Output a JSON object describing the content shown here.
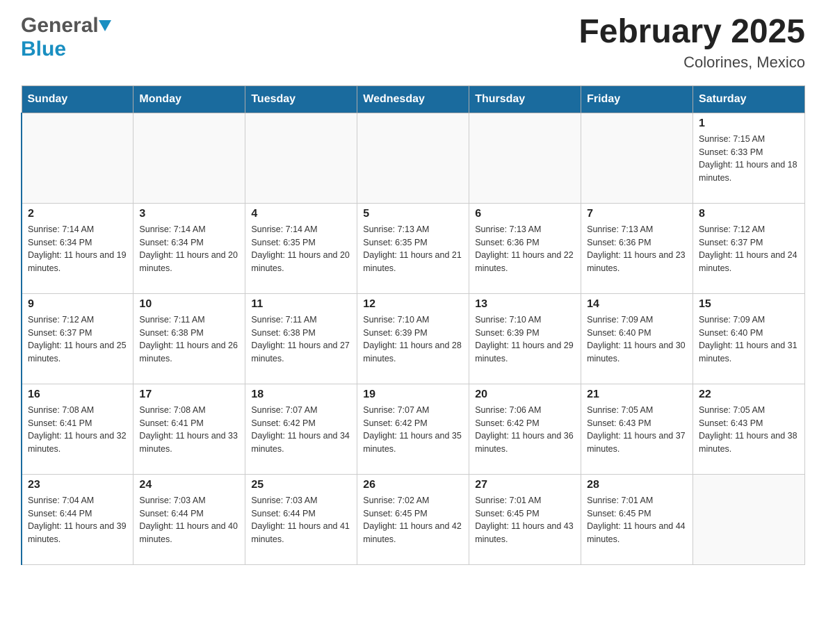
{
  "header": {
    "logo_general": "General",
    "logo_blue": "Blue",
    "month_title": "February 2025",
    "location": "Colorines, Mexico"
  },
  "days_of_week": [
    "Sunday",
    "Monday",
    "Tuesday",
    "Wednesday",
    "Thursday",
    "Friday",
    "Saturday"
  ],
  "weeks": [
    [
      {
        "day": "",
        "info": ""
      },
      {
        "day": "",
        "info": ""
      },
      {
        "day": "",
        "info": ""
      },
      {
        "day": "",
        "info": ""
      },
      {
        "day": "",
        "info": ""
      },
      {
        "day": "",
        "info": ""
      },
      {
        "day": "1",
        "info": "Sunrise: 7:15 AM\nSunset: 6:33 PM\nDaylight: 11 hours and 18 minutes."
      }
    ],
    [
      {
        "day": "2",
        "info": "Sunrise: 7:14 AM\nSunset: 6:34 PM\nDaylight: 11 hours and 19 minutes."
      },
      {
        "day": "3",
        "info": "Sunrise: 7:14 AM\nSunset: 6:34 PM\nDaylight: 11 hours and 20 minutes."
      },
      {
        "day": "4",
        "info": "Sunrise: 7:14 AM\nSunset: 6:35 PM\nDaylight: 11 hours and 20 minutes."
      },
      {
        "day": "5",
        "info": "Sunrise: 7:13 AM\nSunset: 6:35 PM\nDaylight: 11 hours and 21 minutes."
      },
      {
        "day": "6",
        "info": "Sunrise: 7:13 AM\nSunset: 6:36 PM\nDaylight: 11 hours and 22 minutes."
      },
      {
        "day": "7",
        "info": "Sunrise: 7:13 AM\nSunset: 6:36 PM\nDaylight: 11 hours and 23 minutes."
      },
      {
        "day": "8",
        "info": "Sunrise: 7:12 AM\nSunset: 6:37 PM\nDaylight: 11 hours and 24 minutes."
      }
    ],
    [
      {
        "day": "9",
        "info": "Sunrise: 7:12 AM\nSunset: 6:37 PM\nDaylight: 11 hours and 25 minutes."
      },
      {
        "day": "10",
        "info": "Sunrise: 7:11 AM\nSunset: 6:38 PM\nDaylight: 11 hours and 26 minutes."
      },
      {
        "day": "11",
        "info": "Sunrise: 7:11 AM\nSunset: 6:38 PM\nDaylight: 11 hours and 27 minutes."
      },
      {
        "day": "12",
        "info": "Sunrise: 7:10 AM\nSunset: 6:39 PM\nDaylight: 11 hours and 28 minutes."
      },
      {
        "day": "13",
        "info": "Sunrise: 7:10 AM\nSunset: 6:39 PM\nDaylight: 11 hours and 29 minutes."
      },
      {
        "day": "14",
        "info": "Sunrise: 7:09 AM\nSunset: 6:40 PM\nDaylight: 11 hours and 30 minutes."
      },
      {
        "day": "15",
        "info": "Sunrise: 7:09 AM\nSunset: 6:40 PM\nDaylight: 11 hours and 31 minutes."
      }
    ],
    [
      {
        "day": "16",
        "info": "Sunrise: 7:08 AM\nSunset: 6:41 PM\nDaylight: 11 hours and 32 minutes."
      },
      {
        "day": "17",
        "info": "Sunrise: 7:08 AM\nSunset: 6:41 PM\nDaylight: 11 hours and 33 minutes."
      },
      {
        "day": "18",
        "info": "Sunrise: 7:07 AM\nSunset: 6:42 PM\nDaylight: 11 hours and 34 minutes."
      },
      {
        "day": "19",
        "info": "Sunrise: 7:07 AM\nSunset: 6:42 PM\nDaylight: 11 hours and 35 minutes."
      },
      {
        "day": "20",
        "info": "Sunrise: 7:06 AM\nSunset: 6:42 PM\nDaylight: 11 hours and 36 minutes."
      },
      {
        "day": "21",
        "info": "Sunrise: 7:05 AM\nSunset: 6:43 PM\nDaylight: 11 hours and 37 minutes."
      },
      {
        "day": "22",
        "info": "Sunrise: 7:05 AM\nSunset: 6:43 PM\nDaylight: 11 hours and 38 minutes."
      }
    ],
    [
      {
        "day": "23",
        "info": "Sunrise: 7:04 AM\nSunset: 6:44 PM\nDaylight: 11 hours and 39 minutes."
      },
      {
        "day": "24",
        "info": "Sunrise: 7:03 AM\nSunset: 6:44 PM\nDaylight: 11 hours and 40 minutes."
      },
      {
        "day": "25",
        "info": "Sunrise: 7:03 AM\nSunset: 6:44 PM\nDaylight: 11 hours and 41 minutes."
      },
      {
        "day": "26",
        "info": "Sunrise: 7:02 AM\nSunset: 6:45 PM\nDaylight: 11 hours and 42 minutes."
      },
      {
        "day": "27",
        "info": "Sunrise: 7:01 AM\nSunset: 6:45 PM\nDaylight: 11 hours and 43 minutes."
      },
      {
        "day": "28",
        "info": "Sunrise: 7:01 AM\nSunset: 6:45 PM\nDaylight: 11 hours and 44 minutes."
      },
      {
        "day": "",
        "info": ""
      }
    ]
  ]
}
